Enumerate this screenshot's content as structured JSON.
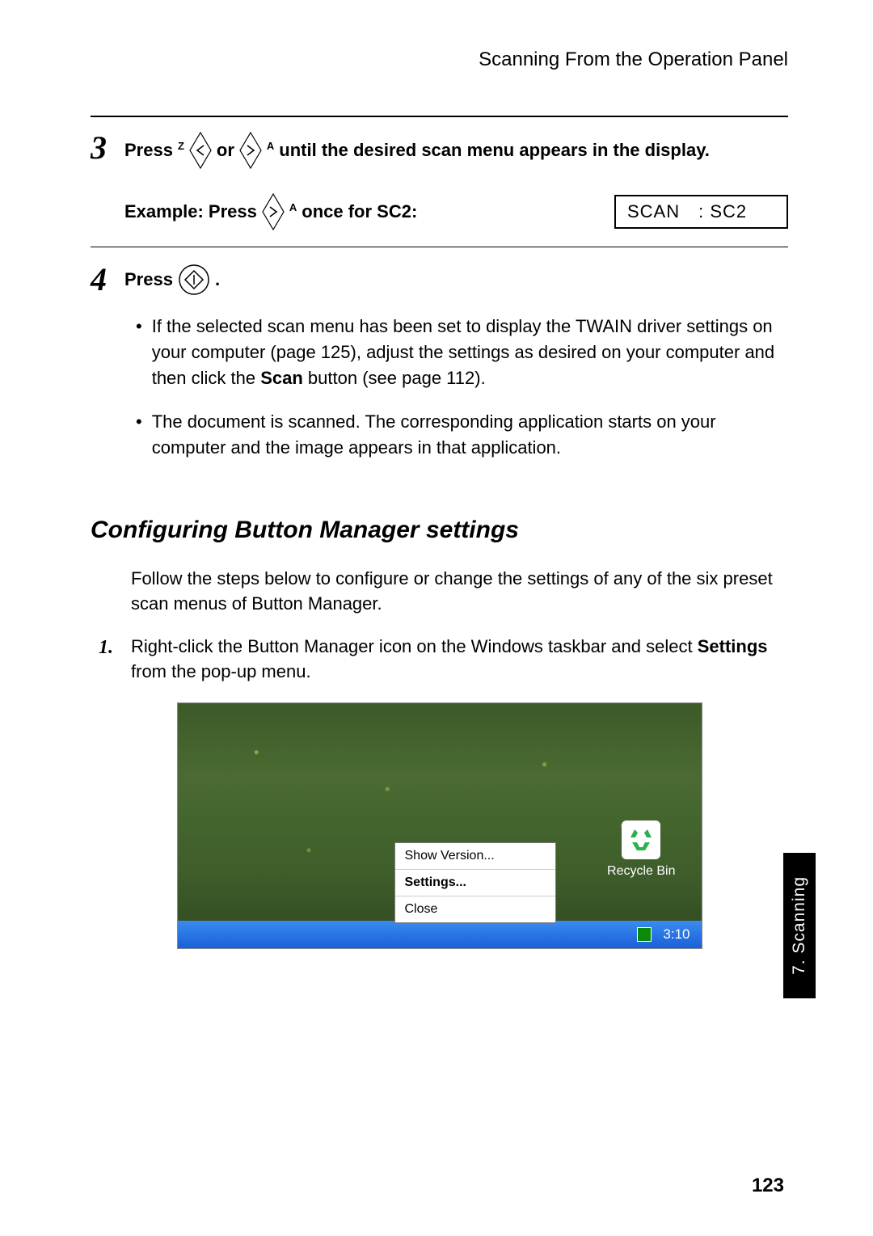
{
  "running_head": "Scanning From the Operation Panel",
  "step3": {
    "num": "3",
    "press": "Press",
    "left_sup": "Z",
    "or": "or",
    "right_sup": "A",
    "rest": "until the desired scan menu appears in the display.",
    "example_prefix": "Example: Press",
    "example_sup": "A",
    "example_suffix": "once for SC2:",
    "display_text": "SCAN : SC2"
  },
  "step4": {
    "num": "4",
    "press": "Press",
    "dot": ".",
    "bullet1_a": "If the selected scan menu has been set to display the TWAIN driver settings on your computer (page 125), adjust the settings as desired on your computer and then click the ",
    "bullet1_bold": "Scan",
    "bullet1_b": " button (see page 112).",
    "bullet2": "The document is scanned. The corresponding application starts on your computer and the image appears in that application."
  },
  "section_title": "Configuring Button Manager settings",
  "intro": "Follow the steps below to configure or change the settings of any of the six preset scan menus of Button Manager.",
  "numstep1": {
    "num": "1.",
    "a": "Right-click the Button Manager icon on the Windows taskbar and select ",
    "bold": "Settings",
    "b": " from the pop-up menu."
  },
  "screenshot": {
    "menu_show_version": "Show Version...",
    "menu_settings": "Settings...",
    "menu_close": "Close",
    "recycle_label": "Recycle Bin",
    "clock": "3:10"
  },
  "side_tab": "7. Scanning",
  "page_number": "123"
}
